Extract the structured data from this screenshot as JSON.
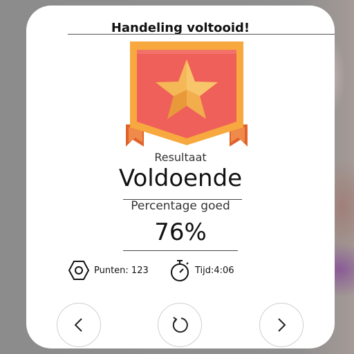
{
  "dialog": {
    "title": "Handeling voltooid!",
    "result_label": "Resultaat",
    "result_value": "Voldoende",
    "percentage_label": "Percentage goed",
    "percentage_value": "76%"
  },
  "stats": {
    "points_text": "Punten: 123",
    "time_text": "Tijd:4:06"
  },
  "icons": {
    "badge": "star-banner-icon",
    "points": "hexagon-nut-icon",
    "time": "stopwatch-icon",
    "prev": "chevron-left-icon",
    "retry": "retry-icon",
    "next": "chevron-right-icon"
  },
  "colors": {
    "banner_red": "#f0605a",
    "banner_orange": "#f7a83e",
    "star_gold": "#f5b857"
  }
}
